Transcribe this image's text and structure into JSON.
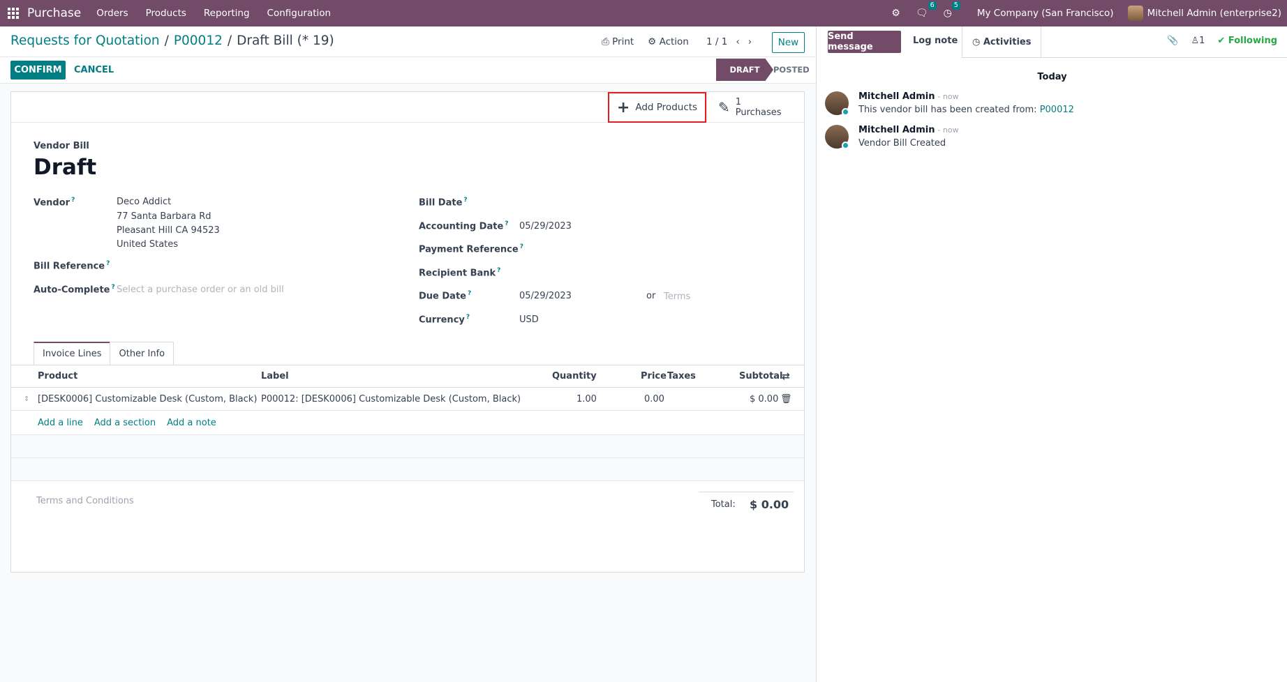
{
  "navbar": {
    "app_name": "Purchase",
    "menu": [
      "Orders",
      "Products",
      "Reporting",
      "Configuration"
    ],
    "messages_badge": "6",
    "activities_badge": "5",
    "company": "My Company (San Francisco)",
    "user": "Mitchell Admin (enterprise2)"
  },
  "breadcrumb": {
    "root": "Requests for Quotation",
    "parent": "P00012",
    "current": "Draft Bill (* 19)"
  },
  "control": {
    "print": "Print",
    "action": "Action",
    "pager": "1 / 1",
    "new": "New"
  },
  "statusbar": {
    "confirm": "CONFIRM",
    "cancel": "CANCEL",
    "states": [
      "DRAFT",
      "POSTED"
    ],
    "active_state": "DRAFT"
  },
  "buttonbox": {
    "add_products": "Add Products",
    "purchases_count": "1",
    "purchases_label": "Purchases"
  },
  "form": {
    "doc_type": "Vendor Bill",
    "name": "Draft",
    "vendor_label": "Vendor",
    "vendor_name": "Deco Addict",
    "vendor_street": "77 Santa Barbara Rd",
    "vendor_city": "Pleasant Hill CA 94523",
    "vendor_country": "United States",
    "bill_reference_label": "Bill Reference",
    "auto_complete_label": "Auto-Complete",
    "auto_complete_placeholder": "Select a purchase order or an old bill",
    "bill_date_label": "Bill Date",
    "accounting_date_label": "Accounting Date",
    "accounting_date": "05/29/2023",
    "payment_reference_label": "Payment Reference",
    "recipient_bank_label": "Recipient Bank",
    "due_date_label": "Due Date",
    "due_date": "05/29/2023",
    "or": "or",
    "terms_placeholder": "Terms",
    "currency_label": "Currency",
    "currency": "USD"
  },
  "tabs": [
    "Invoice Lines",
    "Other Info"
  ],
  "table": {
    "headers": {
      "product": "Product",
      "label": "Label",
      "quantity": "Quantity",
      "price": "Price",
      "taxes": "Taxes",
      "subtotal": "Subtotal"
    },
    "rows": [
      {
        "product": "[DESK0006] Customizable Desk (Custom, Black)",
        "label": "P00012: [DESK0006] Customizable Desk (Custom, Black)",
        "quantity": "1.00",
        "price": "0.00",
        "subtotal": "$ 0.00"
      }
    ],
    "add_line": "Add a line",
    "add_section": "Add a section",
    "add_note": "Add a note"
  },
  "footer": {
    "terms": "Terms and Conditions",
    "total_label": "Total:",
    "total_value": "$ 0.00"
  },
  "chatter": {
    "send_message": "Send message",
    "log_note": "Log note",
    "activities": "Activities",
    "followers_count": "1",
    "following": "Following",
    "date_separator": "Today",
    "messages": [
      {
        "author": "Mitchell Admin",
        "time": "- now",
        "body": "This vendor bill has been created from:",
        "link": "P00012"
      },
      {
        "author": "Mitchell Admin",
        "time": "- now",
        "body": "Vendor Bill Created"
      }
    ]
  },
  "colors": {
    "brand": "#714b67",
    "accent": "#017e84",
    "highlight": "#e02020",
    "following": "#28a745"
  }
}
